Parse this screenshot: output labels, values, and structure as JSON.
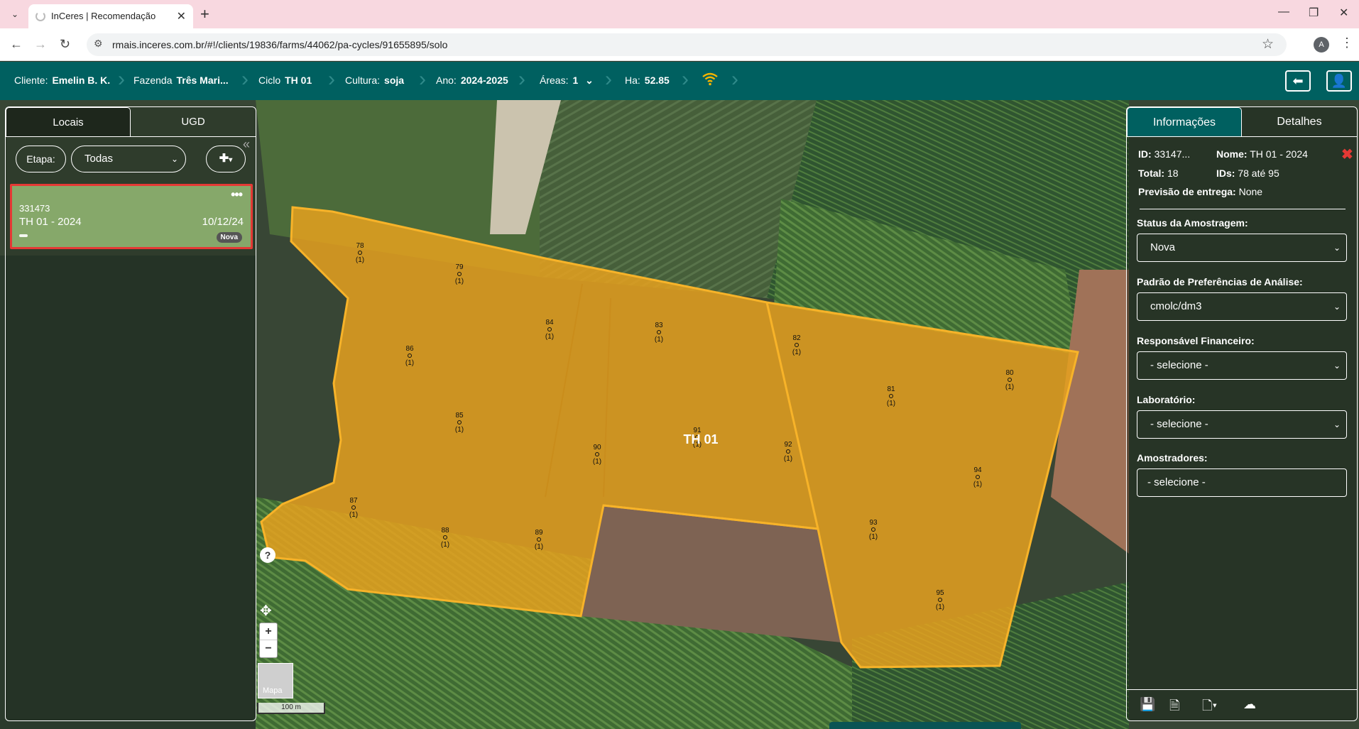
{
  "browser": {
    "tab_title": "InCeres | Recomendação",
    "url": "rmais.inceres.com.br/#!/clients/19836/farms/44062/pa-cycles/91655895/solo",
    "profile_initial": "A"
  },
  "header": {
    "cliente_label": "Cliente:",
    "cliente_value": "Emelin B. K.",
    "fazenda_label": "Fazenda",
    "fazenda_value": "Três Mari...",
    "ciclo_label": "Ciclo",
    "ciclo_value": "TH 01",
    "cultura_label": "Cultura:",
    "cultura_value": "soja",
    "ano_label": "Ano:",
    "ano_value": "2024-2025",
    "areas_label": "Áreas:",
    "areas_value": "1",
    "ha_label": "Ha:",
    "ha_value": "52.85",
    "wifi_color": "#f5b400"
  },
  "left_panel": {
    "tabs": [
      "Locais",
      "UGD"
    ],
    "etapa_label": "Etapa:",
    "etapa_value": "Todas",
    "card": {
      "id": "331473",
      "name": "TH 01 - 2024",
      "date": "10/12/24",
      "badge": "Nova"
    }
  },
  "map": {
    "field_label": "TH 01",
    "field_color": "#e6a11f",
    "points": [
      {
        "id": "78",
        "count": "(1)"
      },
      {
        "id": "79",
        "count": "(1)"
      },
      {
        "id": "84",
        "count": "(1)"
      },
      {
        "id": "83",
        "count": "(1)"
      },
      {
        "id": "86",
        "count": "(1)"
      },
      {
        "id": "82",
        "count": "(1)"
      },
      {
        "id": "80",
        "count": "(1)"
      },
      {
        "id": "81",
        "count": "(1)"
      },
      {
        "id": "85",
        "count": "(1)"
      },
      {
        "id": "91",
        "count": "(1)"
      },
      {
        "id": "90",
        "count": "(1)"
      },
      {
        "id": "92",
        "count": "(1)"
      },
      {
        "id": "94",
        "count": "(1)"
      },
      {
        "id": "87",
        "count": "(1)"
      },
      {
        "id": "88",
        "count": "(1)"
      },
      {
        "id": "89",
        "count": "(1)"
      },
      {
        "id": "93",
        "count": "(1)"
      },
      {
        "id": "95",
        "count": "(1)"
      }
    ],
    "help": "?",
    "zoom_in": "+",
    "zoom_out": "−",
    "layer_label": "Mapa",
    "scale_label": "100 m"
  },
  "right_panel": {
    "tabs": [
      "Informações",
      "Detalhes"
    ],
    "id_label": "ID:",
    "id_value": "33147...",
    "nome_label": "Nome:",
    "nome_value": "TH 01 - 2024",
    "total_label": "Total:",
    "total_value": "18",
    "ids_label": "IDs:",
    "ids_value": "78 até 95",
    "previsao_label": "Previsão de entrega:",
    "previsao_value": "None",
    "status_label": "Status da Amostragem:",
    "status_value": "Nova",
    "padrao_label": "Padrão de Preferências de Análise:",
    "padrao_value": "cmolc/dm3",
    "resp_label": "Responsável Financeiro:",
    "resp_value": "- selecione -",
    "lab_label": "Laboratório:",
    "lab_value": "- selecione -",
    "amostr_label": "Amostradores:",
    "amostr_value": "- selecione -"
  }
}
